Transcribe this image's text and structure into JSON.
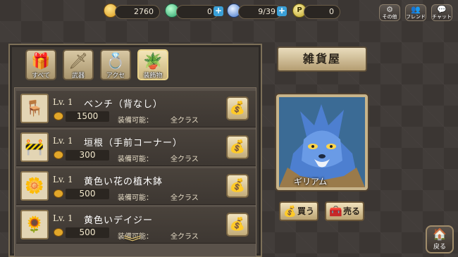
{
  "currency": {
    "gold": "2760",
    "gems": "0",
    "stamina": "9/39",
    "points": "0"
  },
  "top_buttons": [
    {
      "label": "その他",
      "icon": "gear-icon"
    },
    {
      "label": "フレンド",
      "icon": "friends-icon"
    },
    {
      "label": "チャット",
      "icon": "chat-icon"
    }
  ],
  "categories": [
    {
      "label": "すべて",
      "icon": "all-icon"
    },
    {
      "label": "武器",
      "icon": "sword-icon"
    },
    {
      "label": "アクセ",
      "icon": "ring-icon"
    },
    {
      "label": "装飾物",
      "icon": "decoration-icon",
      "active": true
    }
  ],
  "items": [
    {
      "level": "Lv. 1",
      "name": "ベンチ（背なし）",
      "price": "1500",
      "equip_label": "装備可能：",
      "equip_value": "全クラス",
      "icon": "bench-icon"
    },
    {
      "level": "Lv. 1",
      "name": "垣根（手前コーナー）",
      "price": "300",
      "equip_label": "装備可能：",
      "equip_value": "全クラス",
      "icon": "fence-icon"
    },
    {
      "level": "Lv. 1",
      "name": "黄色い花の植木鉢",
      "price": "500",
      "equip_label": "装備可能：",
      "equip_value": "全クラス",
      "icon": "flowerpot-icon"
    },
    {
      "level": "Lv. 1",
      "name": "黄色いデイジー",
      "price": "500",
      "equip_label": "装備可能：",
      "equip_value": "全クラス",
      "icon": "daisy-icon"
    }
  ],
  "shop": {
    "title": "雑貨屋",
    "npc_name": "ギリアム",
    "buy_label": "買う",
    "sell_label": "売る"
  },
  "back_label": "戻る",
  "colors": {
    "accent": "#e2a72a",
    "panel_border": "#7d7058",
    "plus_button": "#3aa0d8"
  }
}
